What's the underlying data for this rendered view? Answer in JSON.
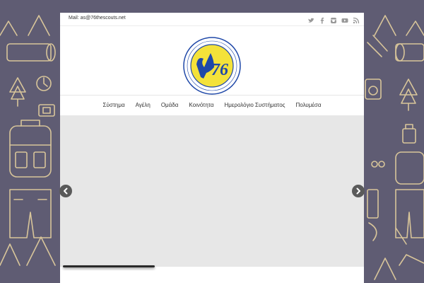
{
  "topbar": {
    "mail": "Mail: as@76thescouts.net",
    "social_icons": [
      "twitter-icon",
      "facebook-icon",
      "instagram-icon",
      "youtube-icon",
      "rss-icon"
    ]
  },
  "logo": {
    "number": "76"
  },
  "nav": {
    "items": [
      "Σύστημα",
      "Αγέλη",
      "Ομάδα",
      "Κοινότητα",
      "Ημερολόγιο Συστήματος",
      "Πολυμέσα"
    ]
  },
  "slider": {
    "prev_icon": "chevron-left-icon",
    "next_icon": "chevron-right-icon"
  },
  "colors": {
    "background": "#5f5c73",
    "pattern_lines": "#d8c59a",
    "logo_yellow": "#f4e23a",
    "logo_blue": "#1f48a8",
    "slider_bg": "#e7e7e7"
  }
}
